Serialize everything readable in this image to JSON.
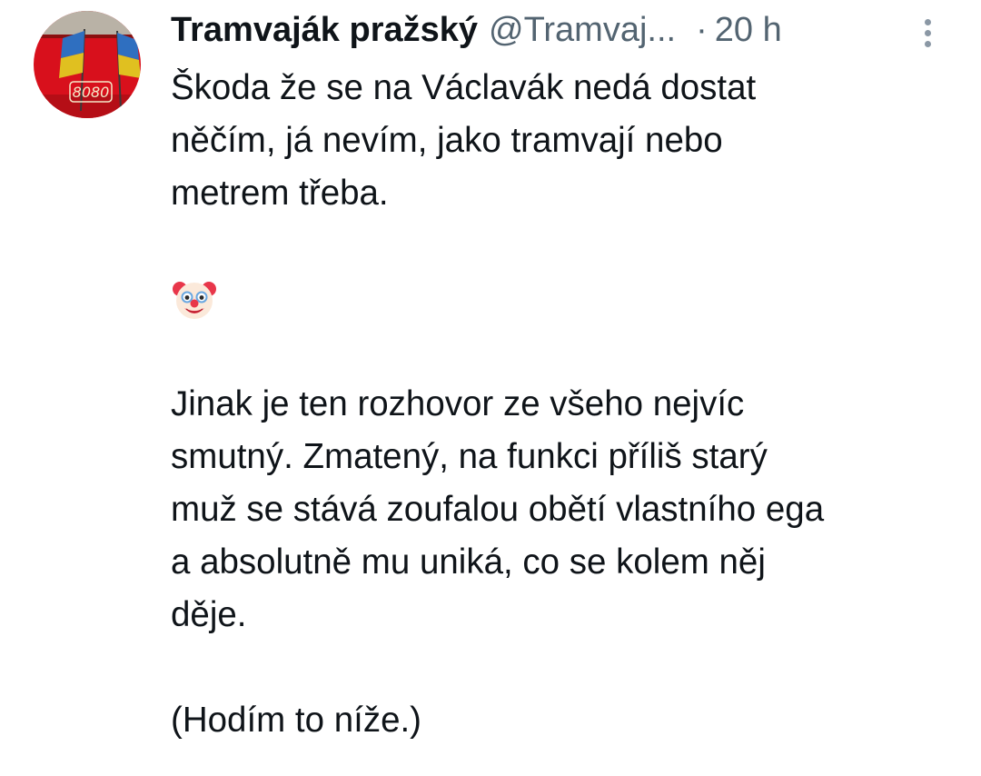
{
  "tweet": {
    "author": {
      "display_name": "Tramvaják pražský",
      "handle": "@Tramvaj...",
      "avatar_text": "8080"
    },
    "separator": "·",
    "time": "20 h",
    "more_icon": "more-vertical-icon",
    "paragraphs": [
      "Škoda že se na Václavák nedá dostat\nněčím, já nevím, jako tramvají nebo\nmetrem třeba.",
      "Jinak je ten rozhovor ze všeho nejvíc\nsmutný. Zmatený, na funkci příliš starý\nmuž se stává zoufalou obětí vlastního ega\na absolutně mu uniká, co se kolem něj\nděje.",
      "(Hodím to níže.)"
    ],
    "emoji": "clown-face-icon",
    "colors": {
      "text": "#0f1419",
      "secondary": "#536471",
      "avatar_red": "#d8101c"
    }
  }
}
